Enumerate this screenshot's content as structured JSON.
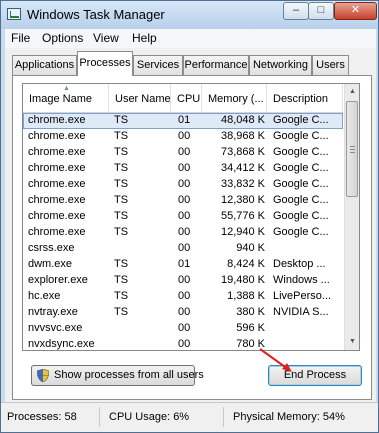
{
  "window": {
    "title": "Windows Task Manager"
  },
  "title_controls": {
    "minimize": "–",
    "maximize": "□",
    "close": "✕"
  },
  "menu": [
    "File",
    "Options",
    "View",
    "Help"
  ],
  "tabs": [
    "Applications",
    "Processes",
    "Services",
    "Performance",
    "Networking",
    "Users"
  ],
  "active_tab": "Processes",
  "columns": [
    "Image Name",
    "User Name",
    "CPU",
    "Memory (...",
    "Description"
  ],
  "sort_indicator": "▲",
  "rows": [
    {
      "name": "chrome.exe",
      "user": "TS",
      "cpu": "01",
      "mem": "48,048 K",
      "desc": "Google C..."
    },
    {
      "name": "chrome.exe",
      "user": "TS",
      "cpu": "00",
      "mem": "38,968 K",
      "desc": "Google C..."
    },
    {
      "name": "chrome.exe",
      "user": "TS",
      "cpu": "00",
      "mem": "73,868 K",
      "desc": "Google C..."
    },
    {
      "name": "chrome.exe",
      "user": "TS",
      "cpu": "00",
      "mem": "34,412 K",
      "desc": "Google C..."
    },
    {
      "name": "chrome.exe",
      "user": "TS",
      "cpu": "00",
      "mem": "33,832 K",
      "desc": "Google C..."
    },
    {
      "name": "chrome.exe",
      "user": "TS",
      "cpu": "00",
      "mem": "12,380 K",
      "desc": "Google C..."
    },
    {
      "name": "chrome.exe",
      "user": "TS",
      "cpu": "00",
      "mem": "55,776 K",
      "desc": "Google C..."
    },
    {
      "name": "chrome.exe",
      "user": "TS",
      "cpu": "00",
      "mem": "12,940 K",
      "desc": "Google C..."
    },
    {
      "name": "csrss.exe",
      "user": "",
      "cpu": "00",
      "mem": "940 K",
      "desc": ""
    },
    {
      "name": "dwm.exe",
      "user": "TS",
      "cpu": "01",
      "mem": "8,424 K",
      "desc": "Desktop ..."
    },
    {
      "name": "explorer.exe",
      "user": "TS",
      "cpu": "00",
      "mem": "19,480 K",
      "desc": "Windows ..."
    },
    {
      "name": "hc.exe",
      "user": "TS",
      "cpu": "00",
      "mem": "1,388 K",
      "desc": "LivePerso..."
    },
    {
      "name": "nvtray.exe",
      "user": "TS",
      "cpu": "00",
      "mem": "380 K",
      "desc": "NVIDIA S..."
    },
    {
      "name": "nvvsvc.exe",
      "user": "",
      "cpu": "00",
      "mem": "596 K",
      "desc": ""
    },
    {
      "name": "nvxdsync.exe",
      "user": "",
      "cpu": "00",
      "mem": "780 K",
      "desc": ""
    }
  ],
  "selected_row": 0,
  "scrollbar": {
    "up": "▲",
    "down": "▼"
  },
  "buttons": {
    "show_all": "Show processes from all users",
    "end_process": "End Process"
  },
  "status": {
    "processes": "Processes: 58",
    "cpu": "CPU Usage: 6%",
    "memory": "Physical Memory: 54%"
  },
  "colors": {
    "frame": "#c9dcef",
    "selection": "#dfeaf8",
    "annotation_arrow": "#e02020"
  }
}
